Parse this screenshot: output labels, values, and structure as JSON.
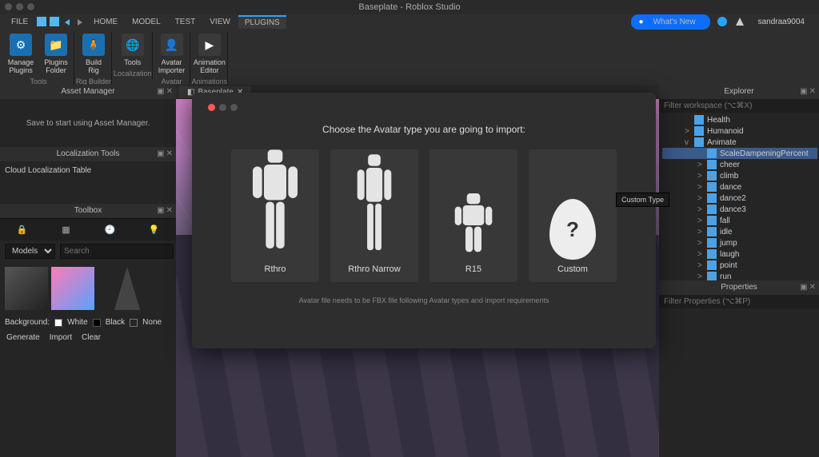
{
  "window": {
    "title": "Baseplate - Roblox Studio"
  },
  "menu": {
    "items": [
      "FILE",
      "HOME",
      "MODEL",
      "TEST",
      "VIEW",
      "PLUGINS"
    ],
    "active": "PLUGINS",
    "whats_new": "What's New",
    "username": "sandraa9004"
  },
  "ribbon": {
    "groups": [
      {
        "label": "Tools",
        "items": [
          {
            "name": "manage-plugins",
            "label": "Manage\nPlugins"
          },
          {
            "name": "plugins-folder",
            "label": "Plugins\nFolder"
          }
        ]
      },
      {
        "label": "Rig Builder",
        "items": [
          {
            "name": "build-rig",
            "label": "Build\nRig"
          }
        ]
      },
      {
        "label": "Localization",
        "items": [
          {
            "name": "tools",
            "label": "Tools"
          }
        ]
      },
      {
        "label": "Avatar",
        "items": [
          {
            "name": "avatar-importer",
            "label": "Avatar\nImporter"
          }
        ]
      },
      {
        "label": "Animations",
        "items": [
          {
            "name": "animation-editor",
            "label": "Animation\nEditor"
          }
        ]
      }
    ]
  },
  "asset_manager": {
    "title": "Asset Manager",
    "message": "Save to start using Asset Manager."
  },
  "localization": {
    "title": "Localization Tools",
    "item": "Cloud Localization Table"
  },
  "toolbox": {
    "title": "Toolbox",
    "category": "Models",
    "search_placeholder": "Search",
    "bg_label": "Background:",
    "bg_options": [
      "White",
      "Black",
      "None"
    ],
    "actions": [
      "Generate",
      "Import",
      "Clear"
    ]
  },
  "tabs": {
    "scene_tab": "Baseplate"
  },
  "dialog": {
    "heading": "Choose the Avatar type you are going to import:",
    "options": [
      {
        "id": "rthro",
        "label": "Rthro"
      },
      {
        "id": "rthro-narrow",
        "label": "Rthro Narrow"
      },
      {
        "id": "r15",
        "label": "R15"
      },
      {
        "id": "custom",
        "label": "Custom",
        "tooltip": "Custom Type"
      }
    ],
    "note": "Avatar file needs to be FBX file following Avatar types and import requirements"
  },
  "explorer": {
    "title": "Explorer",
    "filter_placeholder": "Filter workspace (⌥⌘X)",
    "nodes": [
      {
        "label": "Health",
        "indent": 28,
        "icon": "script"
      },
      {
        "label": "Humanoid",
        "indent": 28,
        "icon": "humanoid",
        "expander": ">"
      },
      {
        "label": "Animate",
        "indent": 28,
        "icon": "script",
        "expander": "v",
        "selected": false
      },
      {
        "label": "ScaleDampeningPercent",
        "indent": 44,
        "icon": "value",
        "selected": true
      },
      {
        "label": "cheer",
        "indent": 44,
        "expander": ">"
      },
      {
        "label": "climb",
        "indent": 44,
        "expander": ">"
      },
      {
        "label": "dance",
        "indent": 44,
        "expander": ">"
      },
      {
        "label": "dance2",
        "indent": 44,
        "expander": ">"
      },
      {
        "label": "dance3",
        "indent": 44,
        "expander": ">"
      },
      {
        "label": "fall",
        "indent": 44,
        "expander": ">"
      },
      {
        "label": "idle",
        "indent": 44,
        "expander": ">"
      },
      {
        "label": "jump",
        "indent": 44,
        "expander": ">"
      },
      {
        "label": "laugh",
        "indent": 44,
        "expander": ">"
      },
      {
        "label": "point",
        "indent": 44,
        "expander": ">"
      },
      {
        "label": "run",
        "indent": 44,
        "expander": ">"
      }
    ]
  },
  "properties": {
    "title": "Properties",
    "filter_placeholder": "Filter Properties (⌥⌘P)"
  }
}
